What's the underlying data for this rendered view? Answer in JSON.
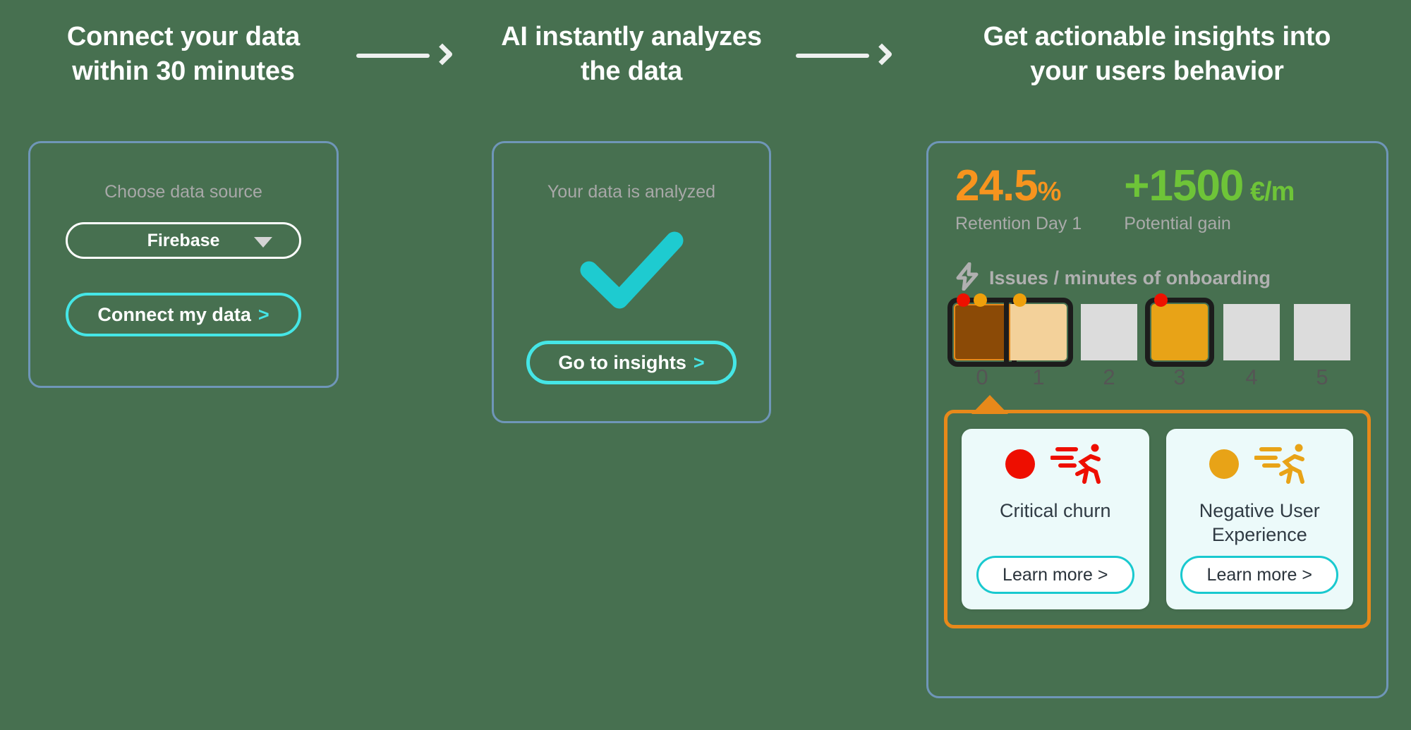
{
  "steps": [
    {
      "heading_line1": "Connect your data",
      "heading_line2": "within 30 minutes",
      "choose_label": "Choose data source",
      "select_value": "Firebase",
      "select_caret_icon": "chevron-down-icon",
      "cta_label": "Connect my data",
      "cta_chevron": ">"
    },
    {
      "heading_line1": "AI instantly analyzes",
      "heading_line2": "the data",
      "status_label": "Your data is analyzed",
      "check_icon": "check-icon",
      "cta_label": "Go to insights",
      "cta_chevron": ">"
    },
    {
      "heading_line1": "Get actionable insights into",
      "heading_line2": "your users behavior"
    }
  ],
  "arrows": {
    "icon": "arrow-right-icon",
    "count": 2
  },
  "insights": {
    "kpis": [
      {
        "value": "24.5",
        "unit": "%",
        "caption": "Retention Day 1",
        "color": "#F7941E"
      },
      {
        "value": "+1500",
        "unit": " €/m",
        "caption": "Potential gain",
        "color": "#6EC438"
      }
    ],
    "issues_header": {
      "icon": "lightning-bolt-icon",
      "label": "Issues / minutes of onboarding"
    },
    "timeline": {
      "ticks": [
        "0",
        "1",
        "2",
        "3",
        "4",
        "5"
      ],
      "slots": [
        {
          "tick": "0",
          "fill": "#8B4A06",
          "selected": true,
          "dots": [
            "red",
            "amber"
          ]
        },
        {
          "tick": "1",
          "fill": "#F3D19A",
          "selected": true,
          "dots": [
            "amber"
          ]
        },
        {
          "tick": "2",
          "fill": "#DCDCDC",
          "selected": false,
          "dots": []
        },
        {
          "tick": "3",
          "fill": "#E8A317",
          "selected": true,
          "dots": [
            "red"
          ]
        },
        {
          "tick": "4",
          "fill": "#DCDCDC",
          "selected": false,
          "dots": []
        },
        {
          "tick": "5",
          "fill": "#DCDCDC",
          "selected": false,
          "dots": []
        }
      ]
    },
    "issue_cards": [
      {
        "severity_dot": "red",
        "runner_icon": "running-person-icon",
        "title": "Critical churn",
        "button_label": "Learn more >",
        "accent": "#EE0E00"
      },
      {
        "severity_dot": "amber",
        "runner_icon": "running-person-icon",
        "title": "Negative User Experience",
        "button_label": "Learn more >",
        "accent": "#E8A317"
      }
    ],
    "container_color": "#E8891A"
  }
}
